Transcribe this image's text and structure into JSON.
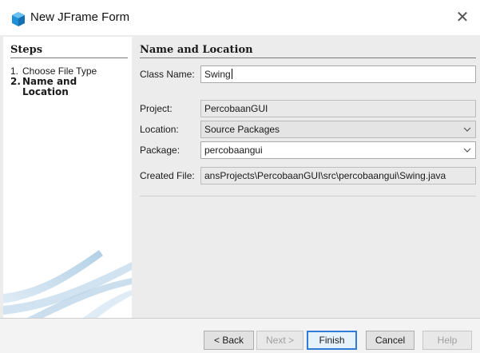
{
  "window": {
    "title": "New JFrame Form",
    "close_glyph": "✕",
    "icon": "netbeans-cube-icon"
  },
  "steps": {
    "heading": "Steps",
    "items": [
      {
        "num": "1.",
        "label": "Choose File Type",
        "current": false
      },
      {
        "num": "2.",
        "label": "Name and Location",
        "current": true
      }
    ]
  },
  "form": {
    "section_title": "Name and Location",
    "class_name": {
      "label": "Class Name:",
      "value": "Swing"
    },
    "project": {
      "label": "Project:",
      "value": "PercobaanGUI"
    },
    "location": {
      "label": "Location:",
      "value": "Source Packages"
    },
    "package": {
      "label": "Package:",
      "value": "percobaangui"
    },
    "created_file": {
      "label": "Created File:",
      "value": "ansProjects\\PercobaanGUI\\src\\percobaangui\\Swing.java"
    }
  },
  "buttons": {
    "back": "< Back",
    "next": "Next >",
    "finish": "Finish",
    "cancel": "Cancel",
    "help": "Help"
  },
  "colors": {
    "accent": "#2f7bd6",
    "panel_bg": "#ececec",
    "icon_blue": "#1f8fd8"
  }
}
